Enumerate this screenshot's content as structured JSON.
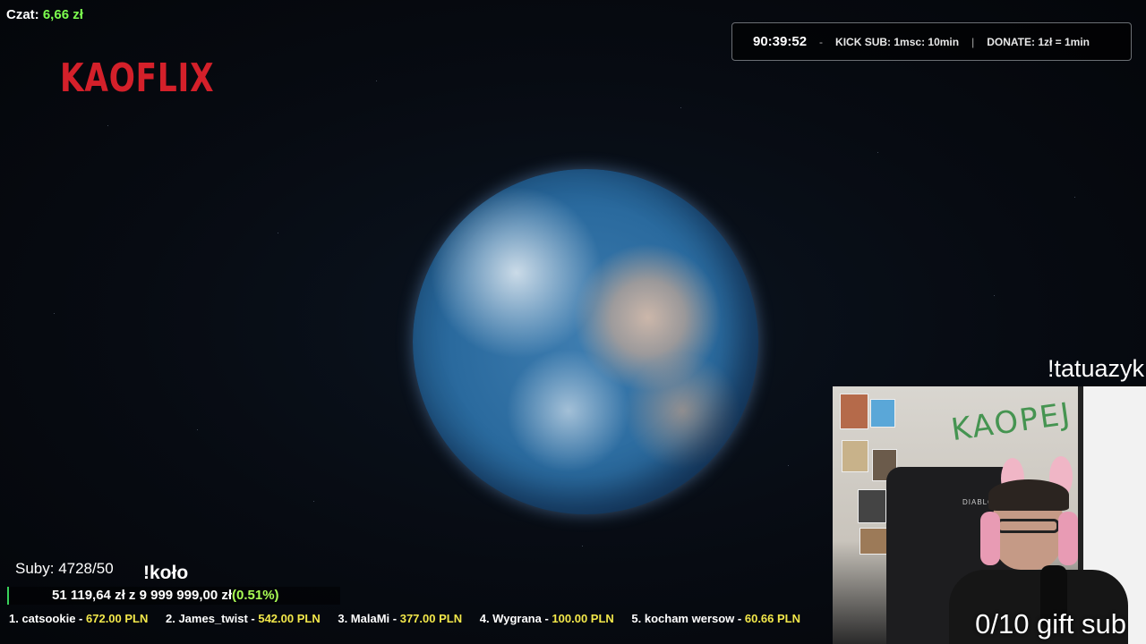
{
  "chat": {
    "label": "Czat:",
    "amount": "6,66 zł"
  },
  "logo": "KAOFLIX",
  "info_box": {
    "timer": "90:39:52",
    "dash": "-",
    "kick_sub": "KICK SUB: 1msc: 10min",
    "divider": "|",
    "donate": "DONATE: 1zł = 1min"
  },
  "command": "!tatuazyk",
  "gift_sub": "0/10 gift sub",
  "subs": "Suby: 4728/50",
  "kolo": "!koło",
  "donation_goal": {
    "current": "51 119,64 zł",
    "of": "z",
    "target": "9 999 999,00 zł",
    "percent": "(0.51%)",
    "progress_fraction": 0.0051
  },
  "leaderboard": [
    {
      "rank_name": "1. catsookie -",
      "amount": "672.00 PLN"
    },
    {
      "rank_name": "2. James_twist -",
      "amount": "542.00 PLN"
    },
    {
      "rank_name": "3. MalaMi -",
      "amount": "377.00 PLN"
    },
    {
      "rank_name": "4. Wygrana -",
      "amount": "100.00 PLN"
    },
    {
      "rank_name": "5. kocham wersow -",
      "amount": "60.66 PLN"
    }
  ],
  "webcam": {
    "chair_brand": "DIABLO",
    "wall_text": "KAOPEJ"
  },
  "colors": {
    "accent_green": "#7dff4f",
    "logo_red": "#d4202a",
    "amount_yellow": "#f3e84a"
  }
}
